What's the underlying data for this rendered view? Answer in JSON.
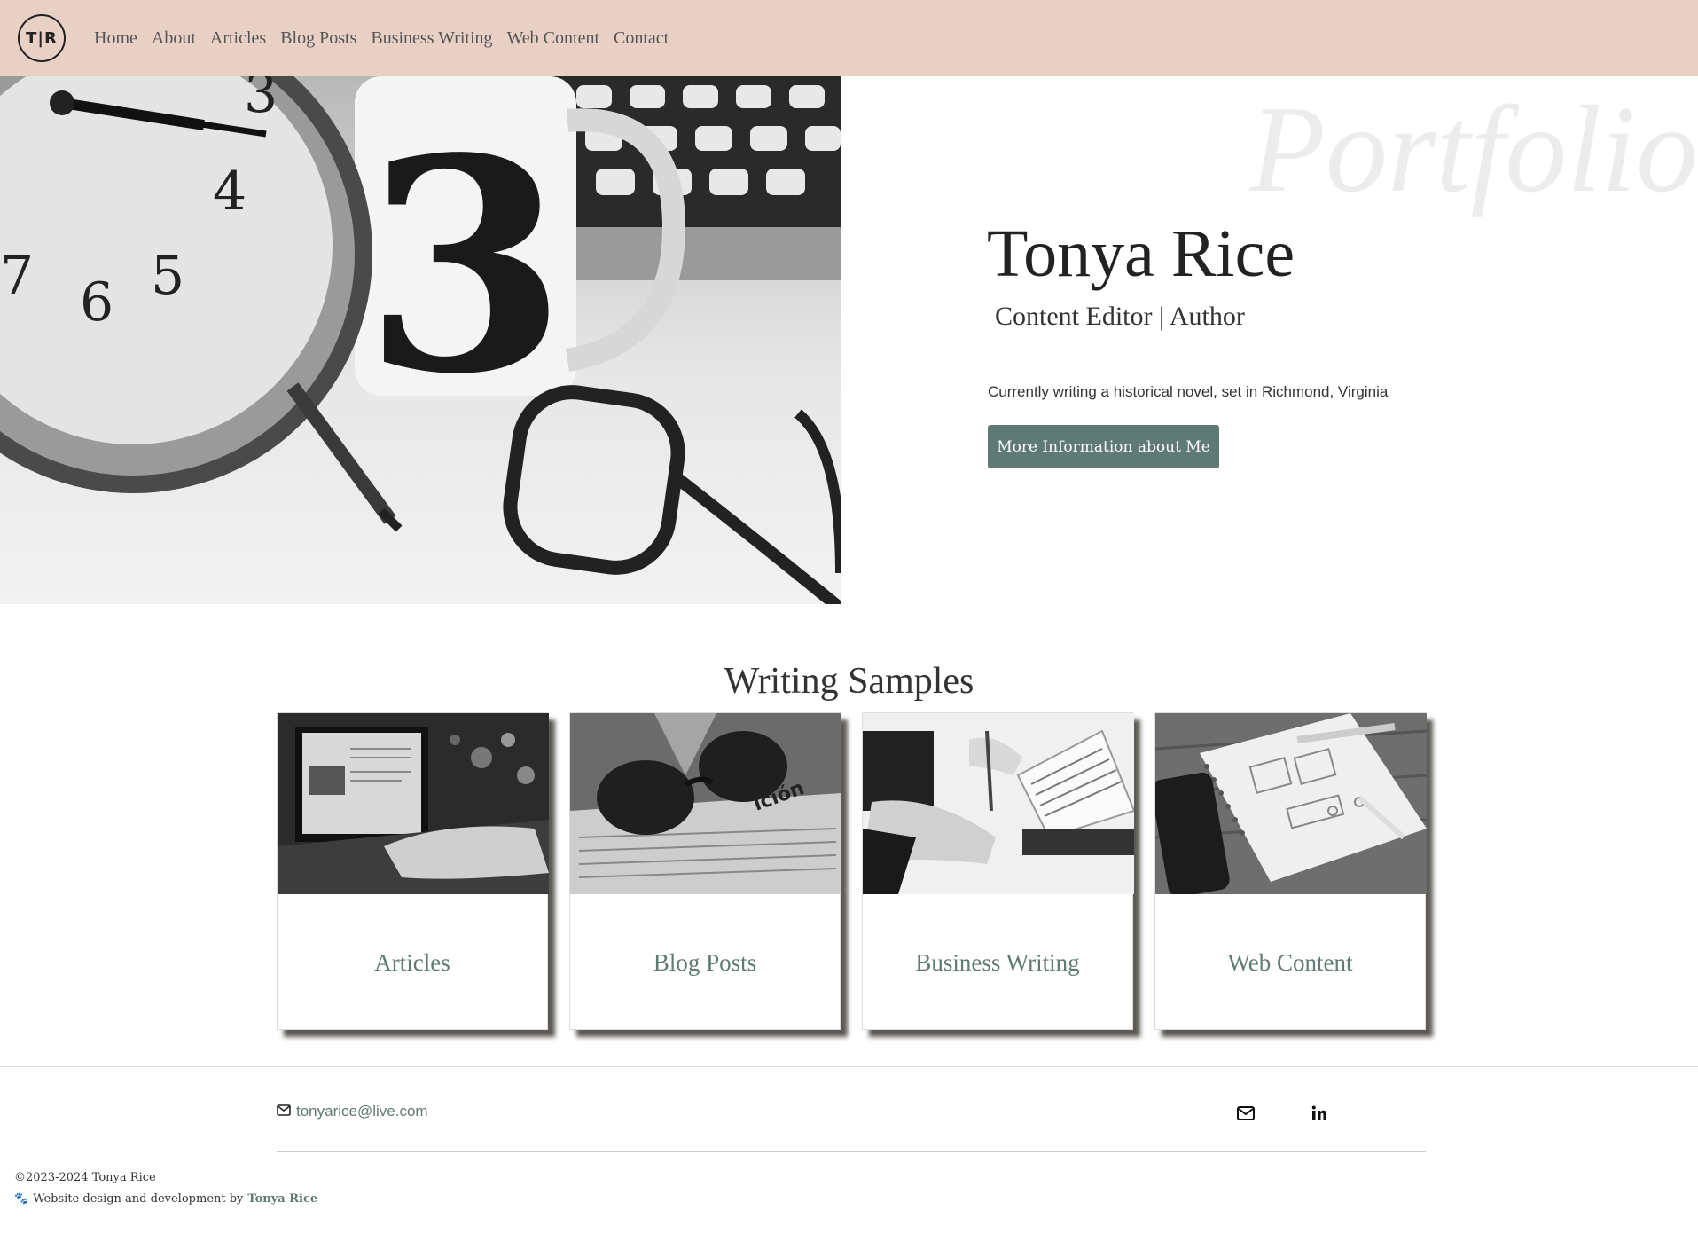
{
  "nav": {
    "logo_text": "T|R",
    "links": [
      "Home",
      "About",
      "Articles",
      "Blog Posts",
      "Business Writing",
      "Web Content",
      "Contact"
    ]
  },
  "hero": {
    "portfolio_word": "Portfolio",
    "name": "Tonya Rice",
    "role": "Content Editor | Author",
    "text": "Currently writing a historical novel, set in Richmond, Virginia",
    "button_label": "More Information about Me"
  },
  "samples": {
    "heading": "Writing Samples",
    "cards": [
      {
        "label": "Articles"
      },
      {
        "label": "Blog Posts"
      },
      {
        "label": "Business Writing"
      },
      {
        "label": "Web Content"
      }
    ]
  },
  "footer": {
    "email": "tonyarice@live.com",
    "social": [
      {
        "icon": "mail-icon"
      },
      {
        "icon": "linkedin-icon"
      }
    ],
    "copyright": "©2023-2024 Tonya Rice",
    "credit_text": "Website design and development by",
    "credit_name": "Tonya Rice"
  },
  "colors": {
    "nav_bg": "#e9d0c4",
    "accent": "#5f7a74"
  }
}
